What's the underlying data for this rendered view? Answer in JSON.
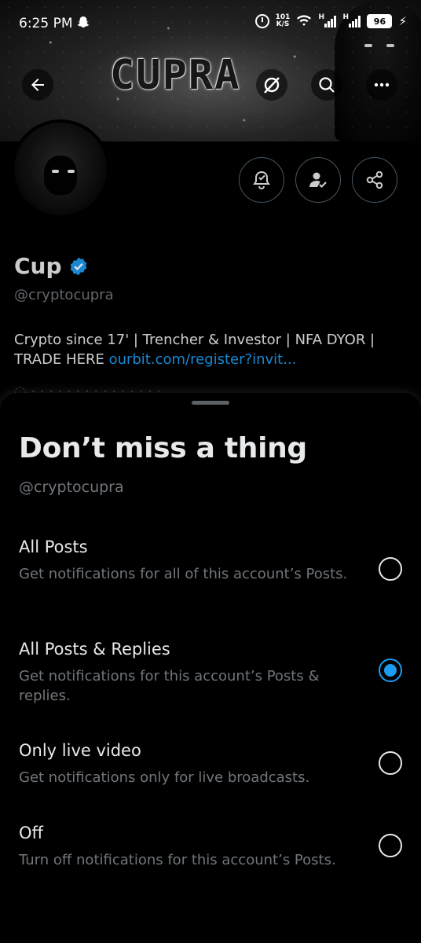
{
  "status_bar": {
    "time": "6:25 PM",
    "net_speed_value": "101",
    "net_speed_unit": "K/S",
    "signal_label_1": "H",
    "signal_label_2": "H",
    "battery": "96"
  },
  "banner": {
    "logo_text": "CUPRA"
  },
  "profile": {
    "display_name": "Cup",
    "handle": "@cryptocupra",
    "bio_text": "Crypto since 17' | Trencher & Investor | NFA DYOR | TRADE HERE ",
    "bio_link": "ourbit.com/register?invit..."
  },
  "sheet": {
    "title": "Don’t miss a thing",
    "handle": "@cryptocupra",
    "options": [
      {
        "title": "All Posts",
        "description": "Get notifications for all of this account’s Posts.",
        "selected": false
      },
      {
        "title": "All Posts & Replies",
        "description": "Get notifications for this account’s Posts & replies.",
        "selected": true
      },
      {
        "title": "Only live video",
        "description": "Get notifications only for live broadcasts.",
        "selected": false
      },
      {
        "title": "Off",
        "description": "Turn off notifications for this account’s Posts.",
        "selected": false
      }
    ]
  },
  "colors": {
    "accent": "#1d9bf0",
    "background": "#000000",
    "secondary_text": "#71767b"
  }
}
